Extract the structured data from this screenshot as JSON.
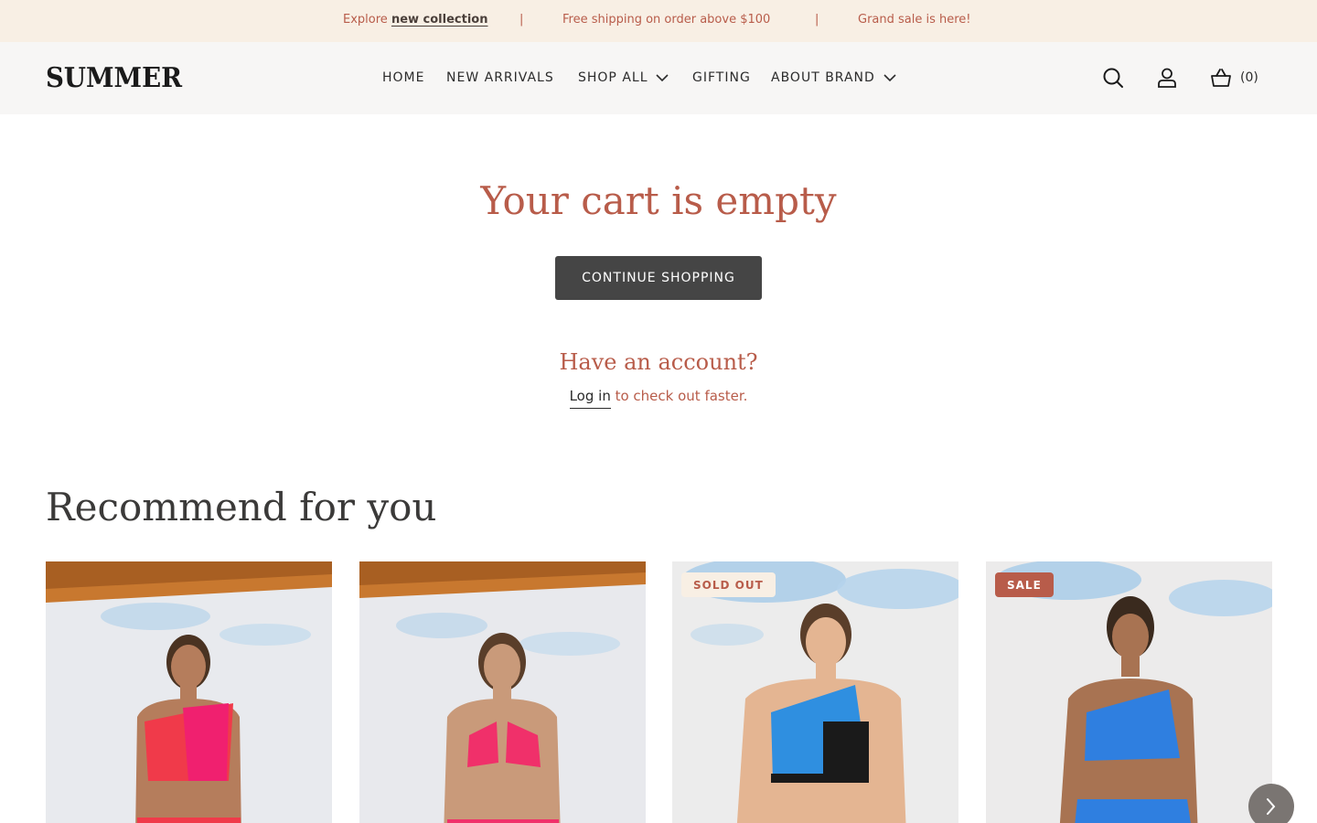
{
  "announcement": {
    "explore_prefix": "Explore",
    "explore_link": "new collection",
    "separator": "|",
    "shipping": "Free shipping on order above $100",
    "sale": "Grand sale is here!"
  },
  "header": {
    "logo": "SUMMER",
    "nav": {
      "home": "HOME",
      "new_arrivals": "NEW ARRIVALS",
      "shop_all": "SHOP ALL",
      "gifting": "GIFTING",
      "about_brand": "ABOUT BRAND"
    },
    "icons": [
      "search-icon",
      "account-icon",
      "cart-icon"
    ],
    "cart_count": "(0)"
  },
  "cart": {
    "empty_title": "Your cart is empty",
    "continue_label": "CONTINUE SHOPPING",
    "account_title": "Have an account?",
    "login_label": "Log in",
    "login_suffix": " to check out faster."
  },
  "recommend": {
    "title": "Recommend for you",
    "products": [
      {
        "badge": "",
        "top_colors": [
          "#f03a4a",
          "#f0206f"
        ]
      },
      {
        "badge": "",
        "top_colors": [
          "#f0306a"
        ]
      },
      {
        "badge": "SOLD OUT",
        "top_colors": [
          "#2f8fe0",
          "#1a1a1a"
        ]
      },
      {
        "badge": "SALE",
        "top_colors": [
          "#2f7fe0"
        ]
      }
    ]
  },
  "colors": {
    "accent": "#b85c4a",
    "announcement_bg": "#f8efe4",
    "header_bg": "#f7f6f5",
    "button_bg": "#454545"
  }
}
